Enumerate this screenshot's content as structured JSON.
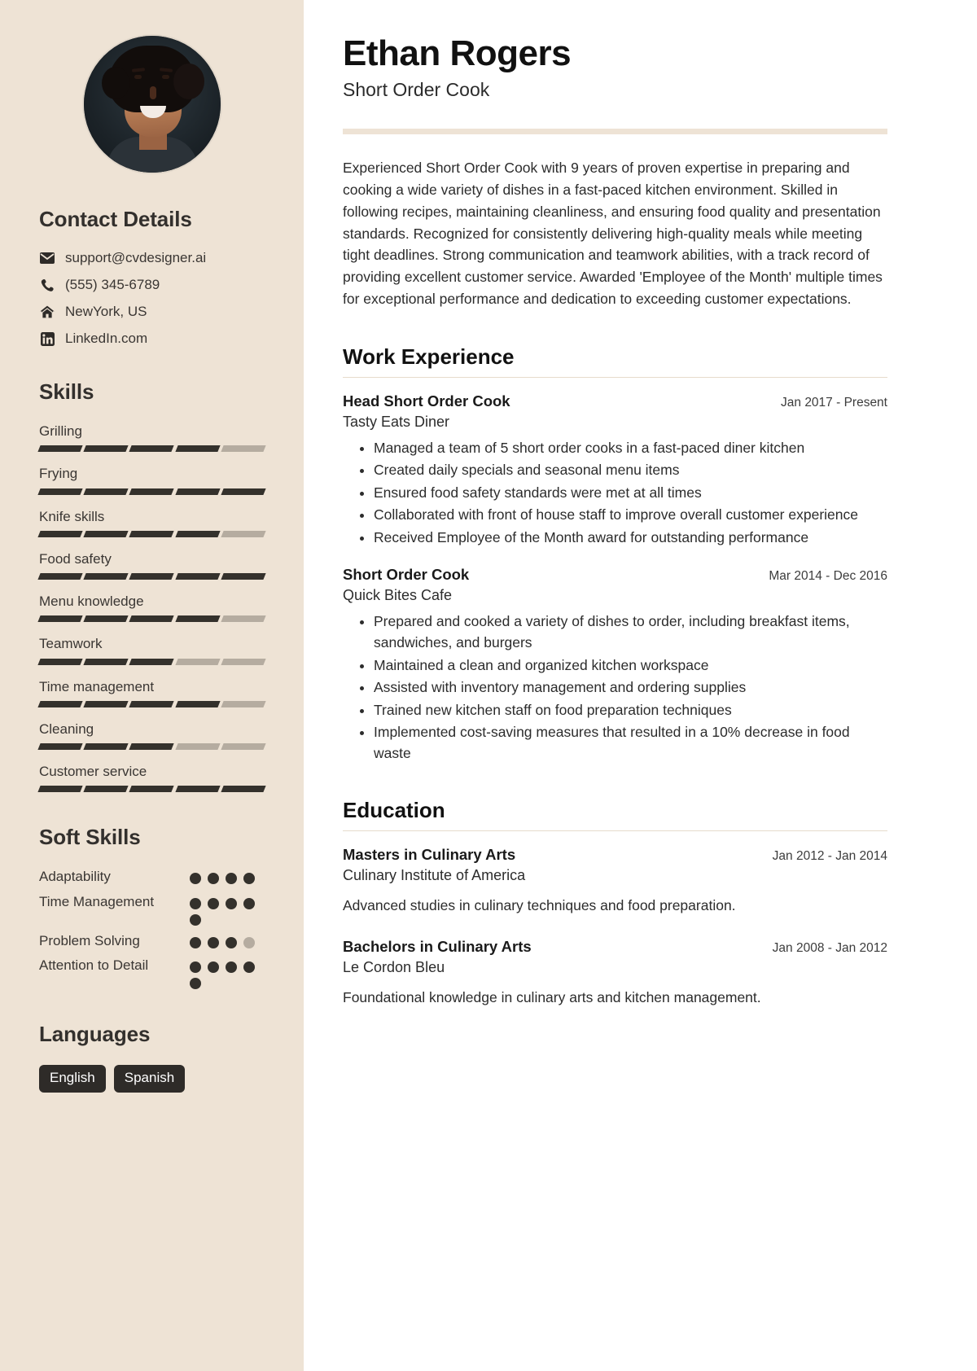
{
  "theme": {
    "sidebar_bg": "#eee3d5",
    "accent_rule": "#eee3d5",
    "dark": "#34312c",
    "muted_bar": "#b5aca0"
  },
  "header": {
    "name": "Ethan Rogers",
    "role": "Short Order Cook"
  },
  "summary": {
    "text": "Experienced Short Order Cook with 9 years of proven expertise in preparing and cooking a wide variety of dishes in a fast-paced kitchen environment. Skilled in following recipes, maintaining cleanliness, and ensuring food quality and presentation standards. Recognized for consistently delivering high-quality meals while meeting tight deadlines. Strong communication and teamwork abilities, with a track record of providing excellent customer service. Awarded 'Employee of the Month' multiple times for exceptional performance and dedication to exceeding customer expectations."
  },
  "sidebar": {
    "contact": {
      "heading": "Contact Details",
      "items": [
        {
          "icon": "envelope-icon",
          "value": "support@cvdesigner.ai"
        },
        {
          "icon": "phone-icon",
          "value": "(555) 345-6789"
        },
        {
          "icon": "home-icon",
          "value": "NewYork, US"
        },
        {
          "icon": "linkedin-icon",
          "value": "LinkedIn.com"
        }
      ]
    },
    "skills": {
      "heading": "Skills",
      "max": 5,
      "items": [
        {
          "label": "Grilling",
          "level": 4
        },
        {
          "label": "Frying",
          "level": 5
        },
        {
          "label": "Knife skills",
          "level": 4
        },
        {
          "label": "Food safety",
          "level": 5
        },
        {
          "label": "Menu knowledge",
          "level": 4
        },
        {
          "label": "Teamwork",
          "level": 3
        },
        {
          "label": "Time management",
          "level": 4
        },
        {
          "label": "Cleaning",
          "level": 3
        },
        {
          "label": "Customer service",
          "level": 5
        }
      ]
    },
    "soft_skills": {
      "heading": "Soft Skills",
      "max": 4,
      "items": [
        {
          "label": "Adaptability",
          "level": 4,
          "dots": 4
        },
        {
          "label": "Time Management",
          "level": 5,
          "dots": 5
        },
        {
          "label": "Problem Solving",
          "level": 3,
          "dots": 4
        },
        {
          "label": "Attention to Detail",
          "level": 5,
          "dots": 5
        }
      ]
    },
    "languages": {
      "heading": "Languages",
      "items": [
        "English",
        "Spanish"
      ]
    }
  },
  "work": {
    "heading": "Work Experience",
    "entries": [
      {
        "title": "Head Short Order Cook",
        "date": "Jan 2017 - Present",
        "org": "Tasty Eats Diner",
        "bullets": [
          "Managed a team of 5 short order cooks in a fast-paced diner kitchen",
          "Created daily specials and seasonal menu items",
          "Ensured food safety standards were met at all times",
          "Collaborated with front of house staff to improve overall customer experience",
          "Received Employee of the Month award for outstanding performance"
        ]
      },
      {
        "title": "Short Order Cook",
        "date": "Mar 2014 - Dec 2016",
        "org": "Quick Bites Cafe",
        "bullets": [
          "Prepared and cooked a variety of dishes to order, including breakfast items, sandwiches, and burgers",
          "Maintained a clean and organized kitchen workspace",
          "Assisted with inventory management and ordering supplies",
          "Trained new kitchen staff on food preparation techniques",
          "Implemented cost-saving measures that resulted in a 10% decrease in food waste"
        ]
      }
    ]
  },
  "education": {
    "heading": "Education",
    "entries": [
      {
        "title": "Masters in Culinary Arts",
        "date": "Jan 2012 - Jan 2014",
        "org": "Culinary Institute of America",
        "description": "Advanced studies in culinary techniques and food preparation."
      },
      {
        "title": "Bachelors in Culinary Arts",
        "date": "Jan 2008 - Jan 2012",
        "org": "Le Cordon Bleu",
        "description": "Foundational knowledge in culinary arts and kitchen management."
      }
    ]
  }
}
